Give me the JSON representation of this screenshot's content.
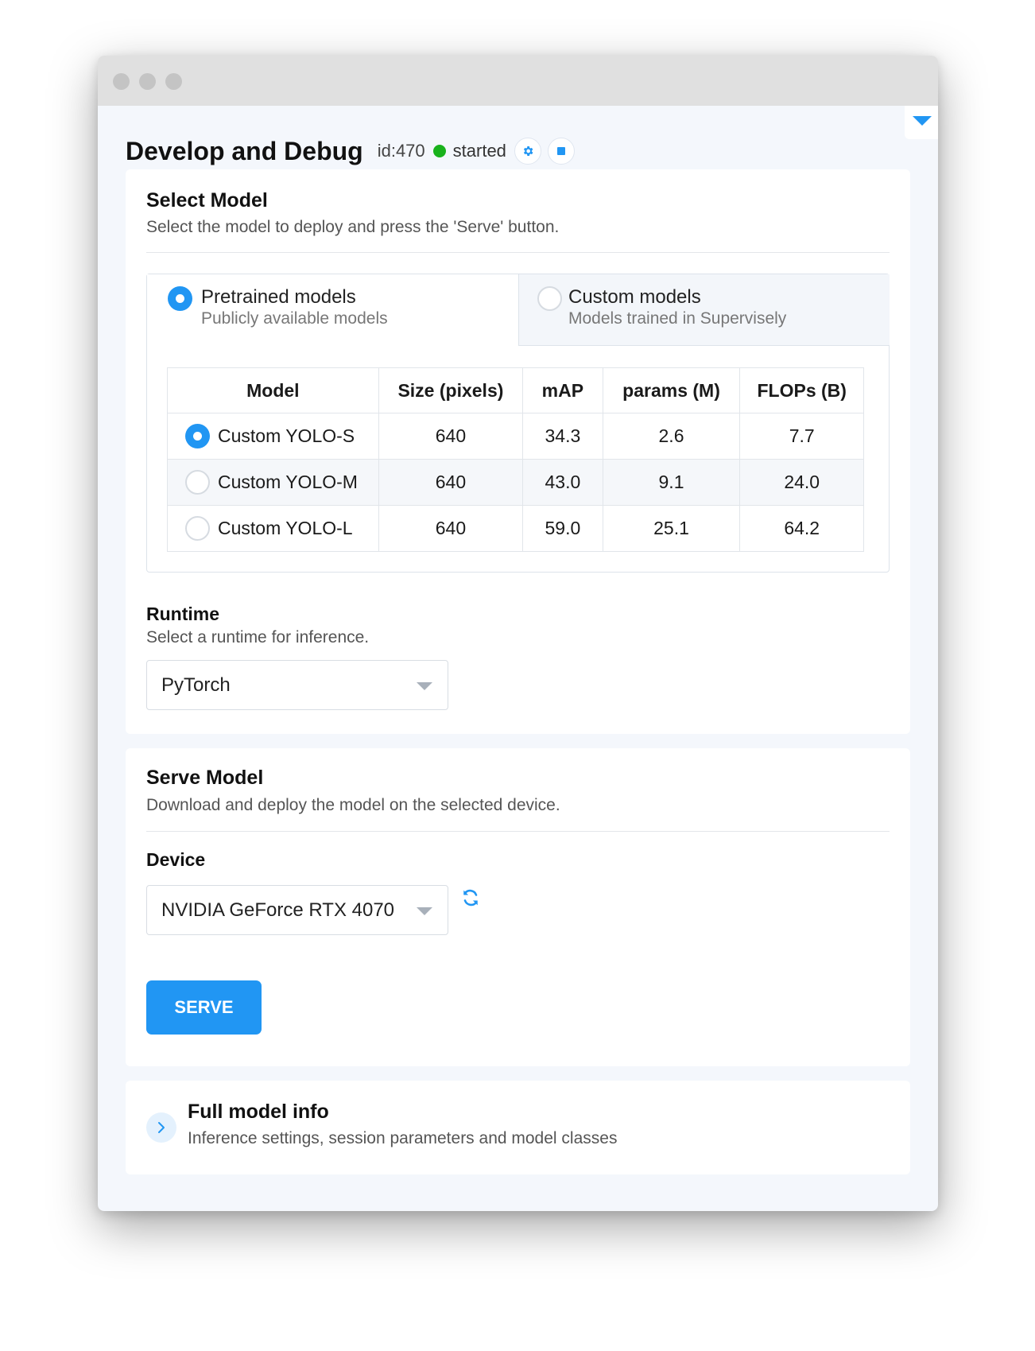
{
  "header": {
    "title": "Develop and Debug",
    "app_id": "id:470",
    "status": "started",
    "status_color": "#19b21c",
    "icons": [
      "gear-icon",
      "stop-icon"
    ]
  },
  "select_model": {
    "title": "Select Model",
    "subtitle": "Select the model to deploy and press the 'Serve' button.",
    "tabs": [
      {
        "label": "Pretrained models",
        "description": "Publicly available models",
        "selected": true
      },
      {
        "label": "Custom models",
        "description": "Models trained in Supervisely",
        "selected": false
      }
    ],
    "table": {
      "columns": [
        "Model",
        "Size (pixels)",
        "mAP",
        "params (M)",
        "FLOPs (B)"
      ],
      "rows": [
        {
          "model": "Custom YOLO-S",
          "size": "640",
          "map": "34.3",
          "params": "2.6",
          "flops": "7.7",
          "selected": true
        },
        {
          "model": "Custom YOLO-M",
          "size": "640",
          "map": "43.0",
          "params": "9.1",
          "flops": "24.0",
          "selected": false
        },
        {
          "model": "Custom YOLO-L",
          "size": "640",
          "map": "59.0",
          "params": "25.1",
          "flops": "64.2",
          "selected": false
        }
      ]
    },
    "runtime": {
      "label": "Runtime",
      "description": "Select a runtime for inference.",
      "value": "PyTorch"
    }
  },
  "serve_model": {
    "title": "Serve Model",
    "subtitle": "Download and deploy the model on the selected device.",
    "device_label": "Device",
    "device_value": "NVIDIA GeForce RTX 4070",
    "serve_label": "SERVE"
  },
  "model_info": {
    "title": "Full model info",
    "subtitle": "Inference settings, session parameters and model classes"
  },
  "colors": {
    "accent": "#2196f3",
    "background": "#f4f7fc",
    "card": "#ffffff"
  }
}
